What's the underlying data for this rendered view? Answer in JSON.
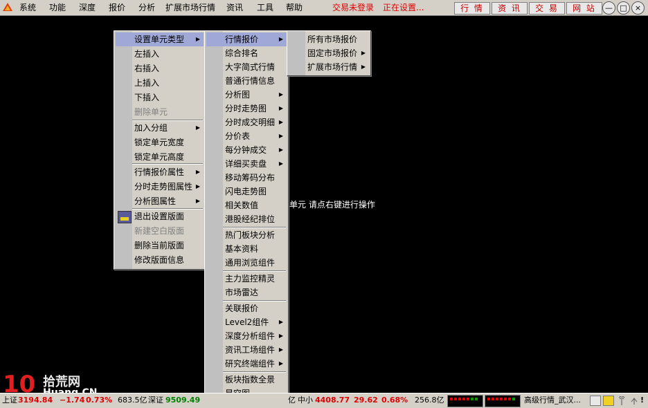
{
  "menubar": {
    "items": [
      "系统",
      "功能",
      "深度",
      "报价",
      "分析",
      "扩展市场行情",
      "资讯",
      "工具",
      "帮助"
    ],
    "trade_status": "交易未登录",
    "setting_status": "正在设置...",
    "buttons": [
      "行 情",
      "资 讯",
      "交 易",
      "网 站"
    ],
    "window_buttons": [
      "—",
      "□",
      "×"
    ]
  },
  "main": {
    "hint": "单元 请点右键进行操作"
  },
  "menu1": {
    "items": [
      {
        "label": "设置单元类型",
        "arrow": "▶",
        "selected": true
      },
      {
        "label": "左插入"
      },
      {
        "label": "右插入"
      },
      {
        "label": "上插入"
      },
      {
        "label": "下插入"
      },
      {
        "label": "删除单元",
        "disabled": true
      },
      {
        "label": "加入分组",
        "arrow": "▶"
      },
      {
        "label": "锁定单元宽度"
      },
      {
        "label": "锁定单元高度"
      },
      {
        "label": "行情报价属性",
        "arrow": "▶"
      },
      {
        "label": "分时走势图属性",
        "arrow": "▶"
      },
      {
        "label": "分析图属性",
        "arrow": "▶"
      },
      {
        "label": "退出设置版面"
      },
      {
        "label": "新建空白版面",
        "disabled": true
      },
      {
        "label": "删除当前版面"
      },
      {
        "label": "修改版面信息"
      }
    ]
  },
  "menu2": {
    "items": [
      {
        "label": "行情报价",
        "arrow": "▶",
        "selected": true
      },
      {
        "label": "综合排名"
      },
      {
        "label": "大字简式行情"
      },
      {
        "label": "普通行情信息"
      },
      {
        "label": "分析图",
        "arrow": "▶"
      },
      {
        "label": "分时走势图",
        "arrow": "▶"
      },
      {
        "label": "分时成交明细",
        "arrow": "▶"
      },
      {
        "label": "分价表",
        "arrow": "▶"
      },
      {
        "label": "每分钟成交",
        "arrow": "▶"
      },
      {
        "label": "详细买卖盘",
        "arrow": "▶"
      },
      {
        "label": "移动筹码分布"
      },
      {
        "label": "闪电走势图"
      },
      {
        "label": "相关数值"
      },
      {
        "label": "港股经纪排位"
      },
      {
        "label": "热门板块分析"
      },
      {
        "label": "基本资料"
      },
      {
        "label": "通用浏览组件"
      },
      {
        "label": "主力监控精灵"
      },
      {
        "label": "市场雷达"
      },
      {
        "label": "关联报价"
      },
      {
        "label": "Level2组件",
        "arrow": "▶"
      },
      {
        "label": "深度分析组件",
        "arrow": "▶"
      },
      {
        "label": "资讯工场组件",
        "arrow": "▶"
      },
      {
        "label": "研究终端组件",
        "arrow": "▶"
      },
      {
        "label": "板块指数全景"
      },
      {
        "label": "星空图"
      }
    ]
  },
  "menu3": {
    "items": [
      {
        "label": "所有市场报价"
      },
      {
        "label": "固定市场报价",
        "arrow": "▶"
      },
      {
        "label": "扩展市场行情",
        "arrow": "▶"
      }
    ]
  },
  "watermark": {
    "num": "10",
    "cn": "拾荒网",
    "en": "Huang.CN"
  },
  "status": {
    "sh_label": "上证",
    "sh_index": "3194.84",
    "sh_change": "−1.74",
    "sh_pct": "0.73%",
    "sh_amount": "683.5亿",
    "sz_label": "深证",
    "sz_index": "9509.49",
    "amt2": "亿",
    "zx_label": "中小",
    "zx_index": "4408.77",
    "zx_change": "29.62",
    "zx_pct": "0.68%",
    "zx_amount": "256.8亿",
    "server": "高级行情_武汉..."
  },
  "colors": {
    "menu_bg": "#d4d0c8",
    "selected": "#a0a8d8",
    "accent_red": "#e00000",
    "up_green": "#008000"
  }
}
